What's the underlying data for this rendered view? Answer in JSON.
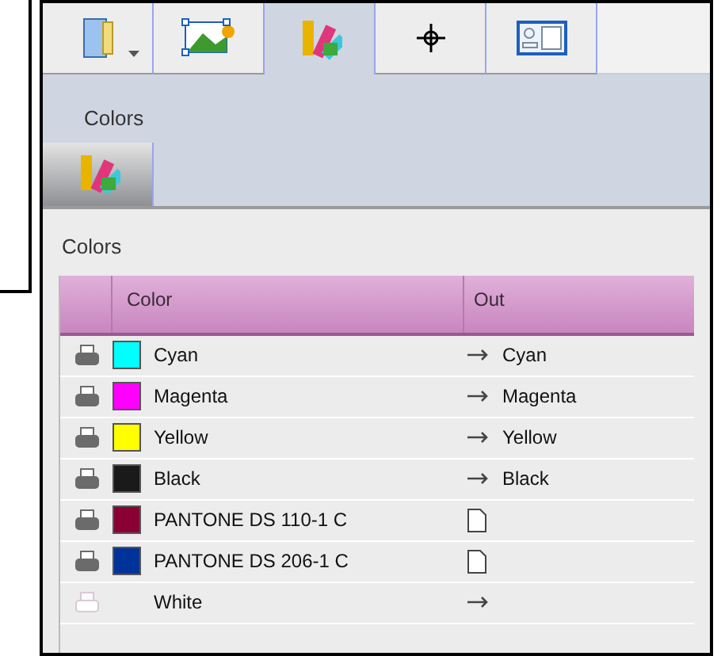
{
  "tabs": [
    {
      "kind": "book",
      "selected": false,
      "has_menu": true
    },
    {
      "kind": "picture",
      "selected": false,
      "has_menu": false
    },
    {
      "kind": "swatches",
      "selected": true,
      "has_menu": false
    },
    {
      "kind": "crosshair",
      "selected": false,
      "has_menu": false
    },
    {
      "kind": "layout",
      "selected": false,
      "has_menu": false
    }
  ],
  "panel": {
    "title": "Colors",
    "subtab": {
      "kind": "swatches",
      "selected": true
    }
  },
  "table": {
    "title": "Colors",
    "columns": [
      "Color",
      "Out"
    ],
    "rows": [
      {
        "printable": true,
        "color": "#00ffff",
        "name": "Cyan",
        "kind": "arrow",
        "out": "Cyan"
      },
      {
        "printable": true,
        "color": "#ff00ff",
        "name": "Magenta",
        "kind": "arrow",
        "out": "Magenta"
      },
      {
        "printable": true,
        "color": "#ffff00",
        "name": "Yellow",
        "kind": "arrow",
        "out": "Yellow"
      },
      {
        "printable": true,
        "color": "#1a1a1a",
        "name": "Black",
        "kind": "arrow",
        "out": "Black"
      },
      {
        "printable": true,
        "color": "#8b0033",
        "name": "PANTONE DS 110-1 C",
        "kind": "document"
      },
      {
        "printable": true,
        "color": "#003399",
        "name": "PANTONE DS 206-1 C",
        "kind": "document"
      },
      {
        "printable": false,
        "name": "White",
        "kind": "arrow"
      }
    ]
  }
}
